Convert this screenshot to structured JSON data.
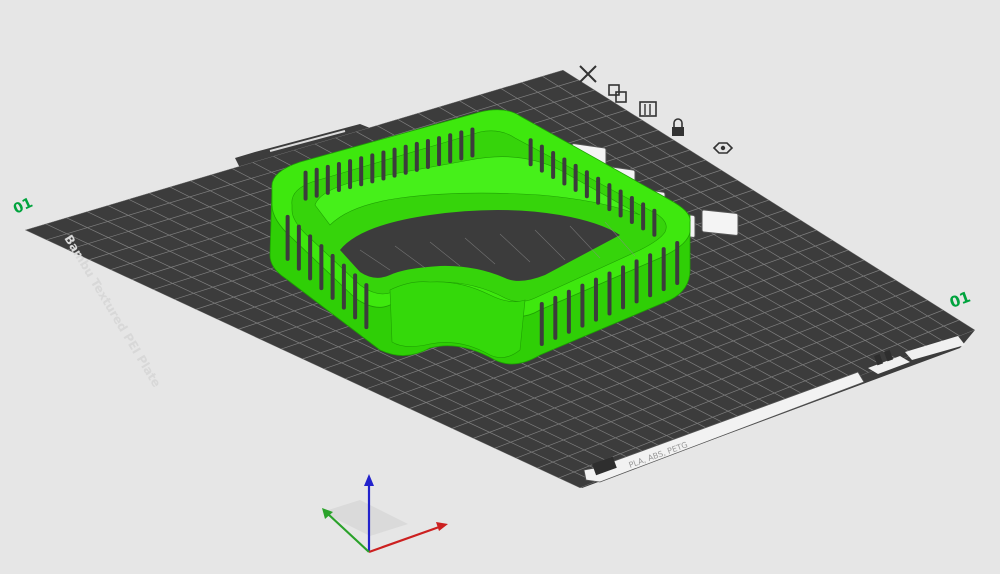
{
  "plate": {
    "name": "Bambu Textured PEI Plate",
    "materials_label": "PLA, ABS, PETG",
    "corner_number_left": "01",
    "corner_number_right": "01"
  },
  "plate_toolbar": {
    "items": [
      {
        "id": "remove",
        "icon": "close-icon"
      },
      {
        "id": "arrange",
        "icon": "arrange-icon"
      },
      {
        "id": "orient",
        "icon": "orient-icon"
      },
      {
        "id": "lock",
        "icon": "lock-icon"
      },
      {
        "id": "settings",
        "icon": "settings-icon"
      }
    ]
  },
  "colors": {
    "background": "#e6e6e6",
    "plate": "#3c3c3c",
    "grid": "#8a8a8a",
    "model": "#3ee80e",
    "accent_green": "#00a33d",
    "axis_x": "#cc2020",
    "axis_y": "#2aa22a",
    "axis_z": "#2222cc"
  }
}
